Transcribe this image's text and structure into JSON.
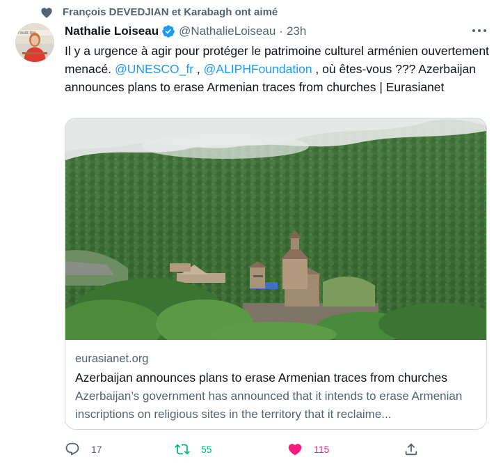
{
  "social_context": {
    "text": "François DEVEDJIAN et Karabagh ont aimé",
    "icon": "heart-icon"
  },
  "author": {
    "name": "Nathalie Loiseau",
    "handle": "@NathalieLoiseau",
    "separator": "·",
    "time": "23h",
    "verified": true,
    "avatar_text": "l'instit litiq"
  },
  "tweet": {
    "part1": "Il y a urgence à agir pour protéger le patrimoine culturel arménien ouvertement menacé. ",
    "mention1": "@UNESCO_fr",
    "part2": " , ",
    "mention2": "@ALIPHFoundation",
    "part3": " , où êtes-vous ??? Azerbaijan announces plans to erase Armenian traces from churches | Eurasianet"
  },
  "card": {
    "domain": "eurasianet.org",
    "title": "Azerbaijan announces plans to erase Armenian traces from churches",
    "description": "Azerbaijan’s government has announced that it intends to erase Armenian inscriptions on religious sites in the territory that it reclaime..."
  },
  "actions": {
    "reply_count": "17",
    "retweet_count": "55",
    "like_count": "115"
  },
  "colors": {
    "accent": "#1d9bf0",
    "retweet": "#00ba7c",
    "like": "#f91880",
    "secondary_text": "#536471"
  }
}
